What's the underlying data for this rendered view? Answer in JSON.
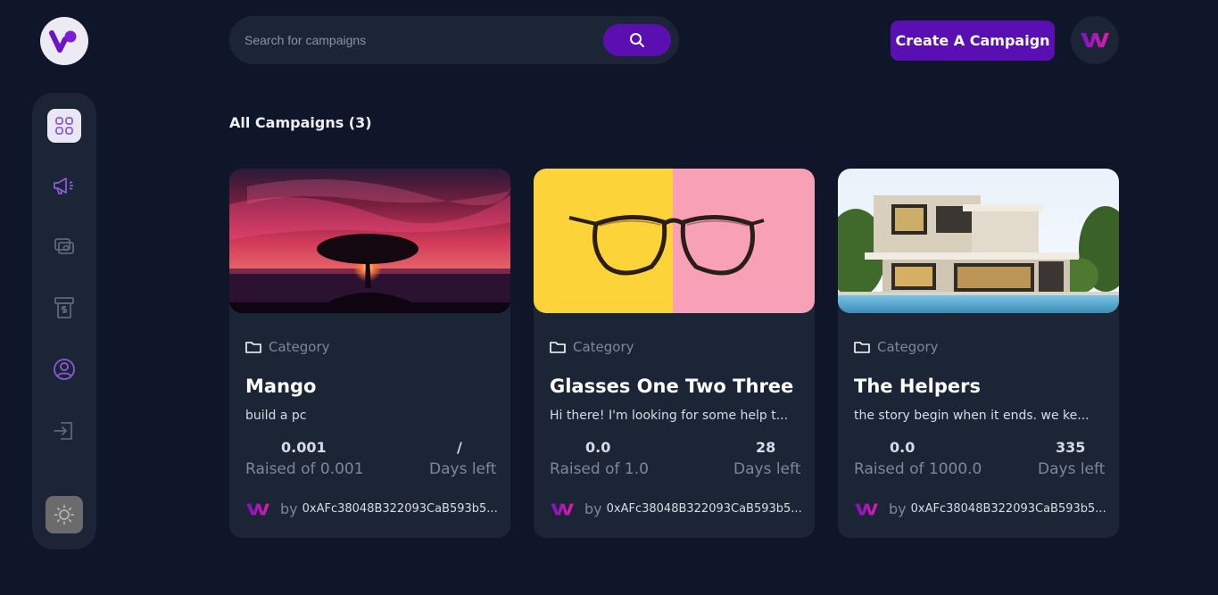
{
  "header": {
    "logo": "v-logo-icon",
    "search": {
      "placeholder": "Search for campaigns",
      "value": ""
    },
    "search_button_icon": "search-icon",
    "create_label": "Create A Campaign",
    "profile_icon": "wm-logo-icon"
  },
  "sidebar": {
    "items": [
      {
        "icon": "dashboard-grid-icon",
        "active": true
      },
      {
        "icon": "megaphone-icon",
        "active": false
      },
      {
        "icon": "payment-icon",
        "active": false
      },
      {
        "icon": "withdraw-icon",
        "active": false
      },
      {
        "icon": "profile-icon",
        "active": false
      },
      {
        "icon": "logout-icon",
        "active": false
      }
    ],
    "theme_icon": "sun-icon"
  },
  "main": {
    "title": "All Campaigns (3)",
    "campaigns": [
      {
        "image": "sunset-tree-image",
        "category": "Category",
        "title": "Mango",
        "description": "build a pc",
        "raised_value": "0.001",
        "raised_label": "Raised of 0.001",
        "days_value": "/",
        "days_label": "Days left",
        "by": "by",
        "owner": "0xAFc38048B322093CaB593b5..."
      },
      {
        "image": "glasses-image",
        "category": "Category",
        "title": "Glasses One Two Three",
        "description": "Hi there! I'm looking for some help t...",
        "raised_value": "0.0",
        "raised_label": "Raised of 1.0",
        "days_value": "28",
        "days_label": "Days left",
        "by": "by",
        "owner": "0xAFc38048B322093CaB593b5..."
      },
      {
        "image": "house-image",
        "category": "Category",
        "title": "The Helpers",
        "description": "the story begin when it ends. we ke...",
        "raised_value": "0.0",
        "raised_label": "Raised of 1000.0",
        "days_value": "335",
        "days_label": "Days left",
        "by": "by",
        "owner": "0xAFc38048B322093CaB593b5..."
      }
    ]
  },
  "colors": {
    "background": "#0f1629",
    "panel": "#1c2536",
    "accent": "#5a0fb2",
    "icon_purple": "#8c5bd6",
    "brand_pink": "#d41bb0"
  }
}
